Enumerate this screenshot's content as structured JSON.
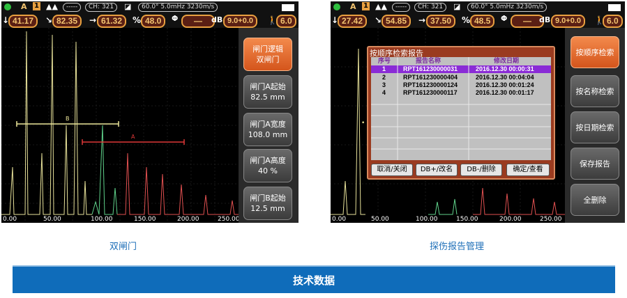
{
  "screen1": {
    "status": {
      "gate_letter": "A",
      "gate_number": "1",
      "ch": "CH: 321",
      "angle_freq": "60.0°  5.0mHz  3230m/s"
    },
    "readouts": {
      "v1": "41.17",
      "v2": "82.35",
      "v3": "61.32",
      "pct": "48.0",
      "db_field": "—",
      "db_unit": "dB",
      "db_value": "9.0+0.0",
      "right_value": "6.0"
    },
    "gate_b_label": "B",
    "gate_a_label": "A",
    "x_ticks": [
      "0.00",
      "50.00",
      "100.00",
      "150.00",
      "200.00",
      "250.00"
    ],
    "side_buttons": [
      {
        "line1": "闸门逻辑",
        "line2": "双闸门"
      },
      {
        "line1": "闸门A起始",
        "line2": "82.5 mm"
      },
      {
        "line1": "闸门A宽度",
        "line2": "108.0 mm"
      },
      {
        "line1": "闸门A高度",
        "line2": "40 %"
      },
      {
        "line1": "闸门B起始",
        "line2": "12.5 mm"
      }
    ],
    "caption": "双闸门"
  },
  "screen2": {
    "status": {
      "gate_letter": "A",
      "gate_number": "1",
      "ch": "CH: 321",
      "angle_freq": "60.0°  5.0mHz  3230m/s"
    },
    "readouts": {
      "v1": "27.42",
      "v2": "54.85",
      "v3": "37.50",
      "pct": "48.5",
      "db_field": "—",
      "db_unit": "dB",
      "db_value": "9.0+0.0",
      "right_value": "6.0"
    },
    "dialog": {
      "title": "按顺序检索报告",
      "headers": [
        "序号",
        "报告名称",
        "修改日期"
      ],
      "rows": [
        {
          "n": "1",
          "name": "RPT161230000031",
          "date": "2016.12.30  00:00:31"
        },
        {
          "n": "2",
          "name": "RPT161230000404",
          "date": "2016.12.30  00:04:04"
        },
        {
          "n": "3",
          "name": "RPT161230000124",
          "date": "2016.12.30  00:01:24"
        },
        {
          "n": "4",
          "name": "RPT161230000117",
          "date": "2016.12.30  00:01:17"
        }
      ],
      "buttons": [
        "取消/关闭",
        "DB+/改名",
        "DB-/删除",
        "确定/查看"
      ]
    },
    "x_ticks": [
      "0.00",
      "50.00",
      "100.00",
      "150.00",
      "200.00",
      "250.00"
    ],
    "side_buttons": [
      "按顺序检索",
      "按名称检索",
      "按日期检索",
      "保存报告",
      "全删除"
    ],
    "caption": "探伤报告管理"
  },
  "banner": "技术数据",
  "colors": {
    "accent_orange": "#e8a040",
    "active_button": "#e06a30",
    "banner_blue": "#0f6cba",
    "caption_blue": "#1e6fb8",
    "selection": "#8a2bd6"
  }
}
